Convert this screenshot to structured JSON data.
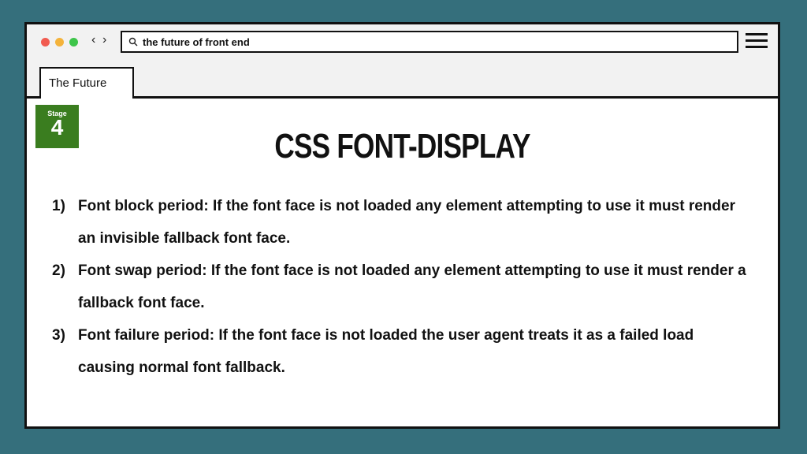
{
  "browser": {
    "search_text": "the future of front end",
    "tab_label": "The Future",
    "back_glyph": "‹",
    "forward_glyph": "›"
  },
  "badge": {
    "label": "Stage",
    "number": "4",
    "color": "#3a7d1f"
  },
  "slide": {
    "title": "CSS FONT-DISPLAY",
    "items": [
      {
        "num": "1)",
        "text": "Font block period: If the font face is not loaded any element attempting to use it must render an invisible fallback font face."
      },
      {
        "num": "2)",
        "text": "Font swap period: If the font face is not loaded any element attempting to use it must render a fallback font face."
      },
      {
        "num": "3)",
        "text": "Font failure period: If the font face is not loaded the user agent treats it as a failed load causing normal font fallback."
      }
    ]
  },
  "colors": {
    "background": "#356f7c",
    "traffic_red": "#f15b50",
    "traffic_yellow": "#f4b33b",
    "traffic_green": "#3ec54a"
  }
}
